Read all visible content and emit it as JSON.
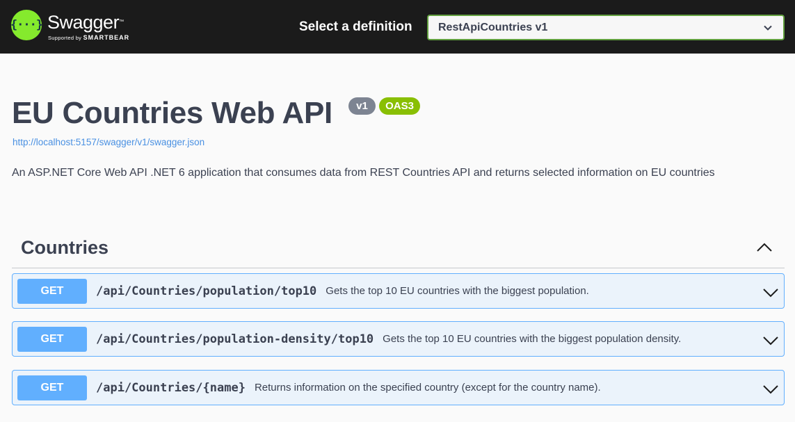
{
  "topbar": {
    "logo_name": "Swagger",
    "logo_tm": "™",
    "logo_supported": "Supported by",
    "logo_brand": "SMARTBEAR",
    "logo_glyph": "{···}",
    "definition_label": "Select a definition",
    "definition_selected": "RestApiCountries v1",
    "accent_color": "#85ea2d"
  },
  "info": {
    "title": "EU Countries Web API",
    "version_badge": "v1",
    "oas_badge": "OAS3",
    "spec_url": "http://localhost:5157/swagger/v1/swagger.json",
    "description": "An ASP.NET Core Web API .NET 6 application that consumes data from REST Countries API and returns selected information on EU countries"
  },
  "tag": {
    "name": "Countries",
    "toggle_icon": "chevron-up-icon"
  },
  "operations": [
    {
      "method": "GET",
      "path": "/api/Countries/population/top10",
      "summary": "Gets the top 10 EU countries with the biggest population."
    },
    {
      "method": "GET",
      "path": "/api/Countries/population-density/top10",
      "summary": "Gets the top 10 EU countries with the biggest population density."
    },
    {
      "method": "GET",
      "path": "/api/Countries/{name}",
      "summary": "Returns information on the specified country (except for the country name)."
    }
  ],
  "colors": {
    "get_method": "#61affe",
    "get_background": "#ebf3fb",
    "oas_badge": "#89bf04",
    "version_badge": "#7d8492"
  }
}
